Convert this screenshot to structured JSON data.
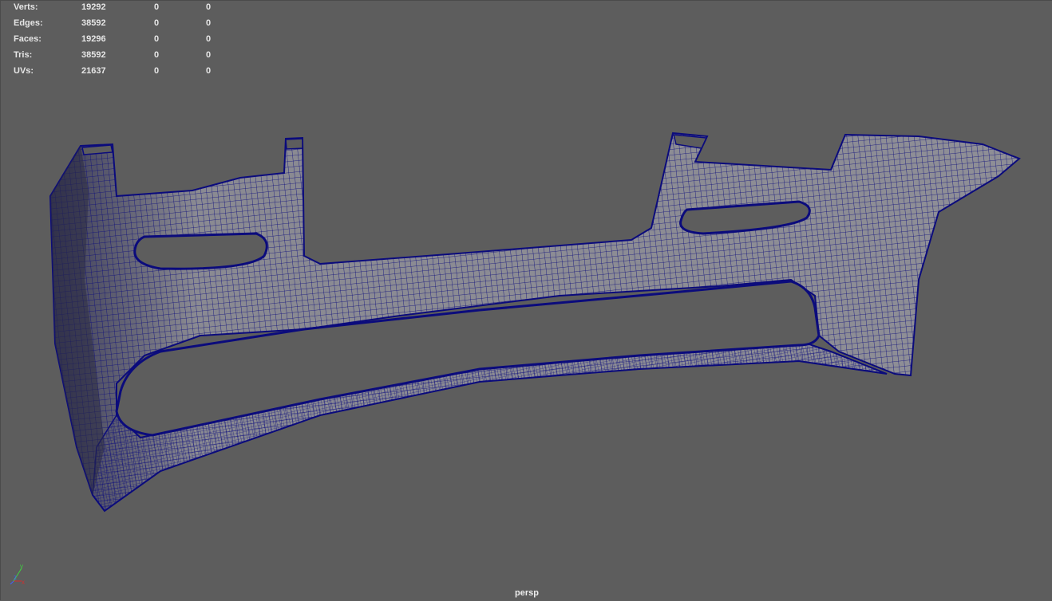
{
  "hud": {
    "rows": [
      {
        "label": "Verts:",
        "count": "19292",
        "selected": "0",
        "component": "0"
      },
      {
        "label": "Edges:",
        "count": "38592",
        "selected": "0",
        "component": "0"
      },
      {
        "label": "Faces:",
        "count": "19296",
        "selected": "0",
        "component": "0"
      },
      {
        "label": "Tris:",
        "count": "38592",
        "selected": "0",
        "component": "0"
      },
      {
        "label": "UVs:",
        "count": "21637",
        "selected": "0",
        "component": "0"
      }
    ]
  },
  "camera": {
    "name": "persp"
  },
  "axis": {
    "y": "y",
    "z": "z",
    "x": "x"
  },
  "colors": {
    "background": "#5d5d5d",
    "wire": "#0b0b7c",
    "surface": "#8a8a92",
    "hud_text": "#e6e6e6",
    "axis_x": "#d03030",
    "axis_y": "#40d040",
    "axis_z": "#4060ff"
  }
}
